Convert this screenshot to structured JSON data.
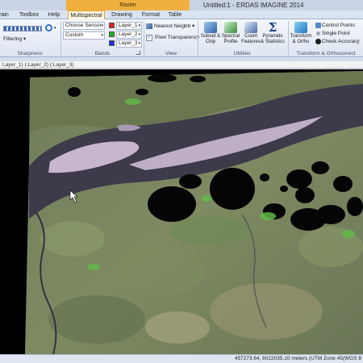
{
  "window": {
    "contextual_group": "Raster",
    "title": "Untitled:1 - ERDAS IMAGINE 2014"
  },
  "tabs": [
    "rain",
    "Toolbox",
    "Help",
    "Multispectral",
    "Drawing",
    "Format",
    "Table"
  ],
  "active_tab": "Multispectral",
  "ribbon": {
    "sharpness": {
      "filtering_label": "Filtering",
      "group_label": "Sharpness"
    },
    "bands": {
      "sensor_value": "Choose Sensor",
      "preset_value": "Custom",
      "layers": [
        {
          "label": "Layer_1",
          "color": "#e02020"
        },
        {
          "label": "Layer_2",
          "color": "#20b020"
        },
        {
          "label": "Layer_3",
          "color": "#2030e0"
        }
      ],
      "group_label": "Bands"
    },
    "view": {
      "resample_value": "Nearest Neighb",
      "pixel_transparency_label": "Pixel Transparency",
      "pixel_transparency_checked": true,
      "group_label": "View"
    },
    "utilities": {
      "buttons": [
        "Subset & Chip",
        "Spectral Profile",
        "Count Features",
        "Pyramids & Statistics"
      ],
      "group_label": "Utilities"
    },
    "transform": {
      "transform_label": "Transform & Ortho",
      "control_points_label": "Control Points",
      "single_point_label": "Single Point",
      "check_accuracy_label": "Check Accuracy",
      "group_label": "Transform & Orthocorrect"
    }
  },
  "viewer": {
    "layer_breadcrumb": "Layer_1) (:Layer_2) (:Layer_3)"
  },
  "status": {
    "coordinates": "457273.64, 8022035.10 meters (UTM Zone 45(WGS 8"
  }
}
